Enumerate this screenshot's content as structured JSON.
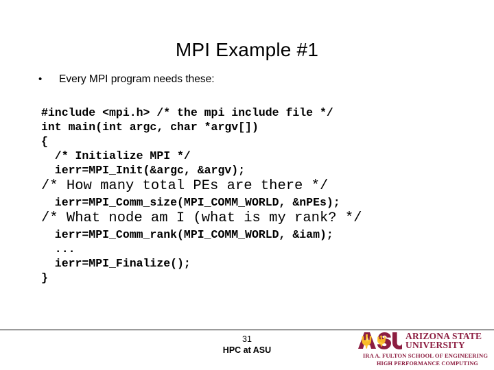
{
  "slide": {
    "title": "MPI Example #1",
    "bullet_marker": "•",
    "bullet_text": "Every MPI program needs these:"
  },
  "code": {
    "lines": [
      {
        "text": "#include <mpi.h> /* the mpi include file */",
        "style": "bold"
      },
      {
        "text": "int main(int argc, char *argv[])",
        "style": "bold"
      },
      {
        "text": "{",
        "style": "bold"
      },
      {
        "text": "  /* Initialize MPI */",
        "style": "bold"
      },
      {
        "text": "  ierr=MPI_Init(&argc, &argv);",
        "style": "bold"
      },
      {
        "text": "/* How many total PEs are there */",
        "style": "light"
      },
      {
        "text": "  ierr=MPI_Comm_size(MPI_COMM_WORLD, &nPEs);",
        "style": "bold"
      },
      {
        "text": "/* What node am I (what is my rank? */",
        "style": "light"
      },
      {
        "text": "  ierr=MPI_Comm_rank(MPI_COMM_WORLD, &iam);",
        "style": "bold"
      },
      {
        "text": "  ...",
        "style": "bold"
      },
      {
        "text": "  ierr=MPI_Finalize();",
        "style": "bold"
      },
      {
        "text": "}",
        "style": "bold"
      }
    ]
  },
  "footer": {
    "slide_number": "31",
    "caption": "HPC at ASU"
  },
  "logo": {
    "mark_text": "ASU",
    "word_line1": "ARIZONA STATE",
    "word_line2": "UNIVERSITY",
    "tagline1": "IRA A. FULTON SCHOOL OF ENGINEERING",
    "tagline2": "HIGH PERFORMANCE COMPUTING",
    "maroon": "#8C1D40",
    "gold": "#FFC627"
  }
}
